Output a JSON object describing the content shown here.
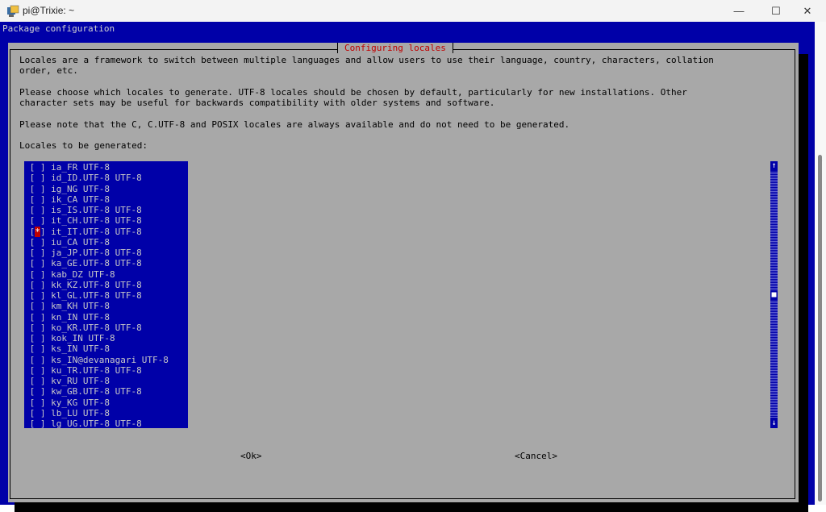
{
  "window": {
    "title": "pi@Trixie: ~",
    "minimize": "—",
    "maximize": "☐",
    "close": "✕"
  },
  "terminal": {
    "header": "Package configuration"
  },
  "dialog": {
    "title": "Configuring locales",
    "paragraphs": [
      "Locales are a framework to switch between multiple languages and allow users to use their language, country, characters, collation\norder, etc.",
      "Please choose which locales to generate. UTF-8 locales should be chosen by default, particularly for new installations. Other\ncharacter sets may be useful for backwards compatibility with older systems and software.",
      "Please note that the C, C.UTF-8 and POSIX locales are always available and do not need to be generated.",
      "Locales to be generated:"
    ],
    "locales": [
      {
        "checked": false,
        "label": "ia_FR UTF-8"
      },
      {
        "checked": false,
        "label": "id_ID.UTF-8 UTF-8"
      },
      {
        "checked": false,
        "label": "ig_NG UTF-8"
      },
      {
        "checked": false,
        "label": "ik_CA UTF-8"
      },
      {
        "checked": false,
        "label": "is_IS.UTF-8 UTF-8"
      },
      {
        "checked": false,
        "label": "it_CH.UTF-8 UTF-8"
      },
      {
        "checked": true,
        "label": "it_IT.UTF-8 UTF-8"
      },
      {
        "checked": false,
        "label": "iu_CA UTF-8"
      },
      {
        "checked": false,
        "label": "ja_JP.UTF-8 UTF-8"
      },
      {
        "checked": false,
        "label": "ka_GE.UTF-8 UTF-8"
      },
      {
        "checked": false,
        "label": "kab_DZ UTF-8"
      },
      {
        "checked": false,
        "label": "kk_KZ.UTF-8 UTF-8"
      },
      {
        "checked": false,
        "label": "kl_GL.UTF-8 UTF-8"
      },
      {
        "checked": false,
        "label": "km_KH UTF-8"
      },
      {
        "checked": false,
        "label": "kn_IN UTF-8"
      },
      {
        "checked": false,
        "label": "ko_KR.UTF-8 UTF-8"
      },
      {
        "checked": false,
        "label": "kok_IN UTF-8"
      },
      {
        "checked": false,
        "label": "ks_IN UTF-8"
      },
      {
        "checked": false,
        "label": "ks_IN@devanagari UTF-8"
      },
      {
        "checked": false,
        "label": "ku_TR.UTF-8 UTF-8"
      },
      {
        "checked": false,
        "label": "kv_RU UTF-8"
      },
      {
        "checked": false,
        "label": "kw_GB.UTF-8 UTF-8"
      },
      {
        "checked": false,
        "label": "ky_KG UTF-8"
      },
      {
        "checked": false,
        "label": "lb_LU UTF-8"
      },
      {
        "checked": false,
        "label": "lg_UG.UTF-8 UTF-8"
      }
    ],
    "checkbox_unchecked": "[ ]",
    "checkbox_checked_mark": "*",
    "scroll_up": "↑",
    "scroll_down": "↓",
    "scroll_thumb": "■",
    "ok_label": "<Ok>",
    "cancel_label": "<Cancel>"
  },
  "colors": {
    "terminal_bg": "#0000a8",
    "dialog_bg": "#a8a8a8",
    "title_red": "#c00000",
    "selected_red": "#c00000"
  }
}
